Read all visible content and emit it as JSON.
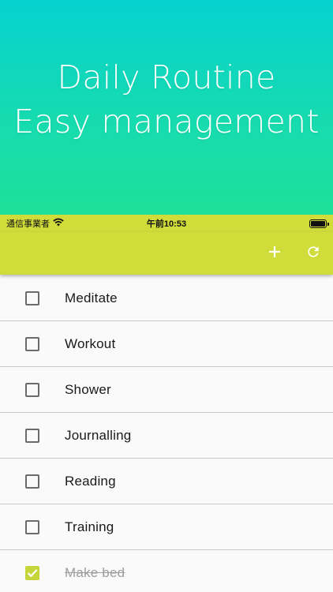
{
  "hero": {
    "line1": "Daily Routine",
    "line2": "Easy management"
  },
  "status_bar": {
    "carrier": "通信事業者",
    "time": "午前10:53"
  },
  "app_bar": {
    "add_icon": "plus-icon",
    "refresh_icon": "refresh-icon"
  },
  "colors": {
    "accent": "#cfdc3a",
    "hero_top": "#06d2d0",
    "hero_bottom": "#1ee09a"
  },
  "tasks": [
    {
      "label": "Meditate",
      "checked": false
    },
    {
      "label": "Workout",
      "checked": false
    },
    {
      "label": "Shower",
      "checked": false
    },
    {
      "label": "Journalling",
      "checked": false
    },
    {
      "label": "Reading",
      "checked": false
    },
    {
      "label": "Training",
      "checked": false
    },
    {
      "label": "Make bed",
      "checked": true
    }
  ]
}
